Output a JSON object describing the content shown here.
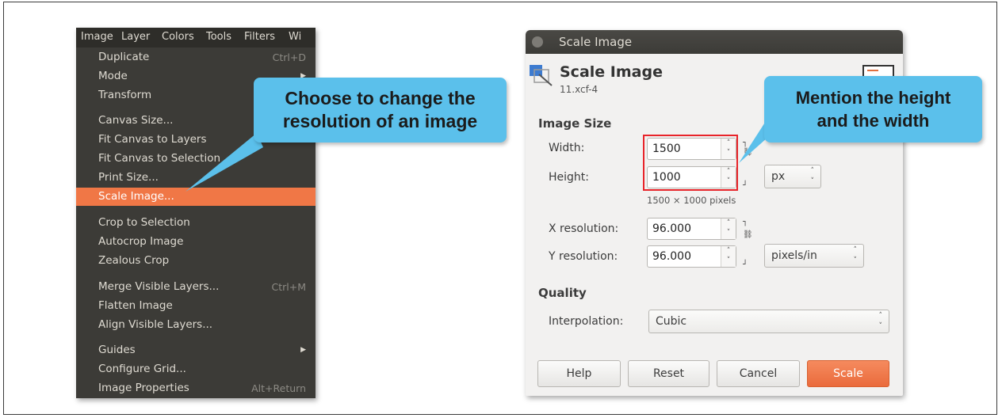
{
  "menu": {
    "menubar": [
      "Image",
      "Layer",
      "Colors",
      "Tools",
      "Filters",
      "Wi"
    ],
    "items": [
      {
        "label": "Duplicate",
        "shortcut": "Ctrl+D"
      },
      {
        "label": "Mode",
        "submenu": true
      },
      {
        "label": "Transform"
      },
      {
        "label": "Canvas Size..."
      },
      {
        "label": "Fit Canvas to Layers"
      },
      {
        "label": "Fit Canvas to Selection"
      },
      {
        "label": "Print Size..."
      },
      {
        "label": "Scale Image...",
        "selected": true
      },
      {
        "label": "Crop to Selection"
      },
      {
        "label": "Autocrop Image"
      },
      {
        "label": "Zealous Crop"
      },
      {
        "label": "Merge Visible Layers...",
        "shortcut": "Ctrl+M"
      },
      {
        "label": "Flatten Image"
      },
      {
        "label": "Align Visible Layers..."
      },
      {
        "label": "Guides",
        "submenu": true
      },
      {
        "label": "Configure Grid..."
      },
      {
        "label": "Image Properties",
        "shortcut": "Alt+Return"
      }
    ]
  },
  "callouts": {
    "left": {
      "line1": "Choose to change the",
      "line2": "resolution of an image"
    },
    "right": {
      "line1": "Mention the height",
      "line2": "and the width"
    }
  },
  "dialog": {
    "window_title": "Scale Image",
    "heading": "Scale Image",
    "subheading": "11.xcf-4",
    "image_size_label": "Image Size",
    "width_label": "Width:",
    "width_value": "1500",
    "height_label": "Height:",
    "height_value": "1000",
    "size_unit": "px",
    "pixels_summary": "1500 × 1000 pixels",
    "xres_label": "X resolution:",
    "xres_value": "96.000",
    "yres_label": "Y resolution:",
    "yres_value": "96.000",
    "res_unit": "pixels/in",
    "quality_label": "Quality",
    "interp_label": "Interpolation:",
    "interp_value": "Cubic",
    "buttons": {
      "help": "Help",
      "reset": "Reset",
      "cancel": "Cancel",
      "scale": "Scale"
    }
  },
  "colors": {
    "accent": "#f07746",
    "callout": "#5bc0eb",
    "highlight_box": "#e8242a",
    "menu_bg": "#3c3b37"
  }
}
